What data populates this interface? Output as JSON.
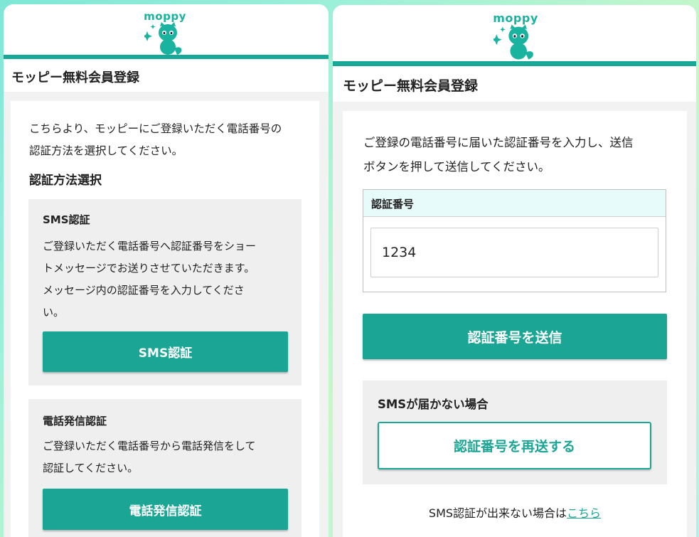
{
  "brand": {
    "logo_text": "moppy",
    "teal": "#17a897",
    "accent_teal": "#1aa595",
    "code_header_bg": "#e7fbfb",
    "icons": [
      "mascot-icon",
      "sparkle-icon"
    ]
  },
  "left_screen": {
    "page_title": "モッピー無料会員登録",
    "intro_line1": "こちらより、モッピーにご登録いただく電話番号の",
    "intro_line2": "認証方法を選択してください。",
    "section_heading": "認証方法選択",
    "sms_method": {
      "title": "SMS認証",
      "desc_line1": "ご登録いただく電話番号へ認証番号をショー",
      "desc_line2": "トメッセージでお送りさせていただきます。",
      "desc_line3": "メッセージ内の認証番号を入力してくださ",
      "desc_line4": "い。",
      "button_label": "SMS認証"
    },
    "call_method": {
      "title": "電話発信認証",
      "desc_line1": "ご登録いただく電話番号から電話発信をして",
      "desc_line2": "認証してください。",
      "button_label": "電話発信認証"
    }
  },
  "right_screen": {
    "page_title": "モッピー無料会員登録",
    "intro_line1": "ご登録の電話番号に届いた認証番号を入力し、送信",
    "intro_line2": "ボタンを押して送信してください。",
    "code_label": "認証番号",
    "code_value": "1234",
    "submit_label": "認証番号を送信",
    "resend_heading": "SMSが届かない場合",
    "resend_label": "認証番号を再送する",
    "footer_text": "SMS認証が出来ない場合は",
    "footer_link": "こちら"
  }
}
